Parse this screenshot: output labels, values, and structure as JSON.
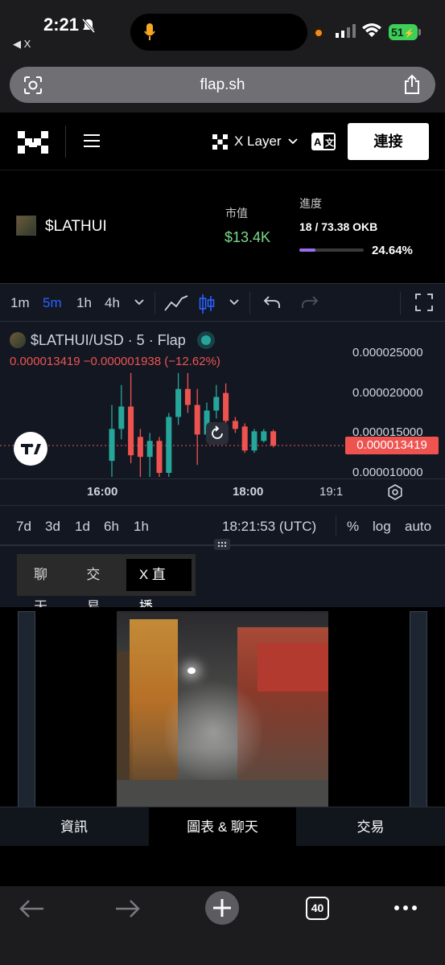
{
  "status_bar": {
    "time": "2:21",
    "back_app": "◀ X",
    "battery": "51"
  },
  "browser": {
    "url": "flap.sh"
  },
  "header": {
    "chain_label": "X Layer",
    "connect_label": "連接"
  },
  "token": {
    "name": "$LATHUI",
    "market_cap_label": "市值",
    "market_cap_value": "$13.4K",
    "progress_label": "進度",
    "progress_value": "18 / 73.38 OKB",
    "progress_pct": "24.64%",
    "progress_fraction": 0.2464
  },
  "chart_toolbar": {
    "timeframes": [
      "1m",
      "5m",
      "1h",
      "4h"
    ],
    "active_timeframe": "5m"
  },
  "chart": {
    "legend_title": "$LATHUI/USD · 5 · Flap",
    "ohlc_line": "0.000013419  −0.000001938 (−12.62%)",
    "price_ticks": [
      "0.000025000",
      "0.000020000",
      "0.000015000",
      "0.000010000"
    ],
    "last_price": "0.000013419",
    "time_ticks": [
      "16:00",
      "18:00",
      "19:1"
    ],
    "up_color": "#26a69a",
    "down_color": "#ef5350"
  },
  "chart_data": {
    "type": "candlestick",
    "title": "$LATHUI/USD · 5 · Flap",
    "y_ticks": [
      2.5e-05,
      2e-05,
      1.5e-05,
      1e-05
    ],
    "x_ticks": [
      "16:00",
      "18:00",
      "19:1"
    ],
    "last": 1.3419e-05,
    "change": -1.938e-06,
    "change_pct": -12.62,
    "candles": [
      {
        "dir": "up",
        "o": 1.15e-05,
        "c": 1.55e-05,
        "h": 1.85e-05,
        "l": 9.3e-06
      },
      {
        "dir": "up",
        "o": 1.55e-05,
        "c": 1.83e-05,
        "h": 2.1e-05,
        "l": 1.42e-05
      },
      {
        "dir": "down",
        "o": 1.83e-05,
        "c": 1.22e-05,
        "h": 2.25e-05,
        "l": 1.12e-05
      },
      {
        "dir": "down",
        "o": 1.45e-05,
        "c": 1.2e-05,
        "h": 1.55e-05,
        "l": 9.3e-06
      },
      {
        "dir": "up",
        "o": 1.2e-05,
        "c": 1.4e-05,
        "h": 1.5e-05,
        "l": 9.3e-06
      },
      {
        "dir": "down",
        "o": 1.4e-05,
        "c": 1e-05,
        "h": 1.45e-05,
        "l": 9.3e-06
      },
      {
        "dir": "up",
        "o": 1e-05,
        "c": 1.7e-05,
        "h": 1.75e-05,
        "l": 9.3e-06
      },
      {
        "dir": "up",
        "o": 1.7e-05,
        "c": 2.05e-05,
        "h": 2.25e-05,
        "l": 1.6e-05
      },
      {
        "dir": "down",
        "o": 2.05e-05,
        "c": 1.85e-05,
        "h": 2.25e-05,
        "l": 1.75e-05
      },
      {
        "dir": "down",
        "o": 1.85e-05,
        "c": 1.48e-05,
        "h": 2.05e-05,
        "l": 1.1e-05
      },
      {
        "dir": "up",
        "o": 1.48e-05,
        "c": 1.78e-05,
        "h": 1.88e-05,
        "l": 1.4e-05
      },
      {
        "dir": "up",
        "o": 1.78e-05,
        "c": 1.95e-05,
        "h": 2.1e-05,
        "l": 1.68e-05
      },
      {
        "dir": "down",
        "o": 2e-05,
        "c": 1.65e-05,
        "h": 2.12e-05,
        "l": 1.6e-05
      },
      {
        "dir": "down",
        "o": 1.65e-05,
        "c": 1.55e-05,
        "h": 1.7e-05,
        "l": 1.5e-05
      },
      {
        "dir": "down",
        "o": 1.58e-05,
        "c": 1.28e-05,
        "h": 1.62e-05,
        "l": 1.25e-05
      },
      {
        "dir": "up",
        "o": 1.28e-05,
        "c": 1.52e-05,
        "h": 1.55e-05,
        "l": 1.25e-05
      },
      {
        "dir": "up",
        "o": 1.4e-05,
        "c": 1.52e-05,
        "h": 1.55e-05,
        "l": 1.38e-05
      },
      {
        "dir": "down",
        "o": 1.52e-05,
        "c": 1.34e-05,
        "h": 1.54e-05,
        "l": 1.32e-05
      }
    ]
  },
  "range_bar": {
    "ranges": [
      "7d",
      "3d",
      "1d",
      "6h",
      "1h"
    ],
    "clock": "18:21:53 (UTC)",
    "pct": "%",
    "log": "log",
    "auto": "auto"
  },
  "tabs": [
    "聊天",
    "交易",
    "X 直播"
  ],
  "active_tab": "X 直播",
  "bottom_nav": [
    "資訊",
    "圖表 & 聊天",
    "交易"
  ],
  "active_nav": "圖表 & 聊天",
  "safari": {
    "tabs_count": "40"
  }
}
